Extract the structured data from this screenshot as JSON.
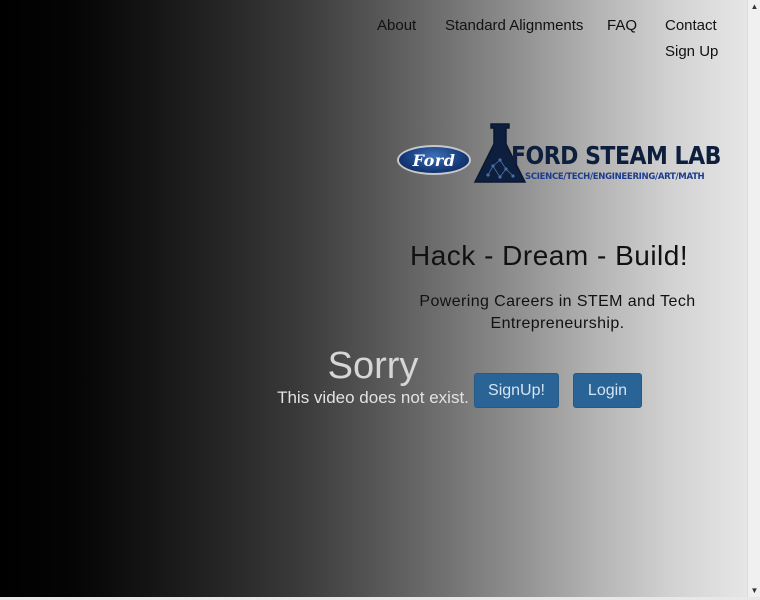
{
  "nav": {
    "about": "About",
    "standards": "Standard Alignments",
    "faq": "FAQ",
    "contact": "Contact",
    "signup": "Sign Up"
  },
  "logo": {
    "ford": "Ford",
    "brand": "FORD STEAM LAB",
    "tagline": "SCIENCE/TECH/ENGINEERING/ART/MATH"
  },
  "hero": {
    "headline": "Hack - Dream - Build!",
    "subline": "Powering Careers in STEM and Tech Entrepreneurship."
  },
  "video": {
    "title": "Sorry",
    "message": "This video does not exist."
  },
  "buttons": {
    "signup": "SignUp!",
    "login": "Login"
  },
  "colors": {
    "button_bg": "#2a6496",
    "brand_navy": "#0d1f3d"
  }
}
